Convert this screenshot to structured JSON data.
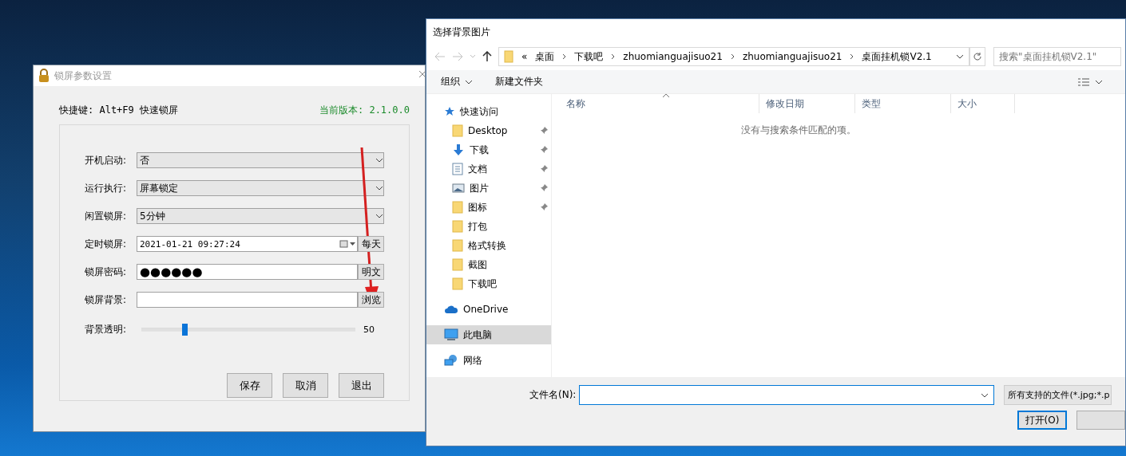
{
  "lock_dialog": {
    "title": "锁屏参数设置",
    "shortcut": "快捷键: Alt+F9 快速锁屏",
    "version": "当前版本: 2.1.0.0",
    "fields": [
      {
        "kind": "select",
        "label": "开机启动:",
        "value": "否"
      },
      {
        "kind": "select",
        "label": "运行执行:",
        "value": "屏幕锁定"
      },
      {
        "kind": "select",
        "label": "闲置锁屏:",
        "value": "5分钟"
      },
      {
        "kind": "datetime",
        "label": "定时锁屏:",
        "value": "2021-01-21 09:27:24",
        "button": "每天"
      },
      {
        "kind": "password",
        "label": "锁屏密码:",
        "value": "●●●●●●",
        "button": "明文"
      },
      {
        "kind": "file",
        "label": "锁屏背景:",
        "button": "浏览"
      },
      {
        "kind": "slider",
        "label": "背景透明:",
        "level": 0.2,
        "reading": "50"
      }
    ],
    "buttons": [
      "保存",
      "取消",
      "退出"
    ]
  },
  "file_dialog": {
    "title": "选择背景图片",
    "path_prefix": "«",
    "breadcrumbs": [
      "桌面",
      "下载吧",
      "zhuomianguajisuo21",
      "zhuomianguajisuo21",
      "桌面挂机锁V2.1"
    ],
    "search": {
      "placeholder": "搜索\"桌面挂机锁V2.1\""
    },
    "toolbar": {
      "organize": "组织",
      "new_folder": "新建文件夹"
    },
    "sidebar": [
      {
        "kind": "star",
        "label": "快速访问",
        "selected": false,
        "children": [
          {
            "kind": "folder",
            "label": "Desktop",
            "pinned": true,
            "selected": false
          },
          {
            "kind": "download",
            "label": "下载",
            "pinned": true,
            "selected": false
          },
          {
            "kind": "document",
            "label": "文档",
            "pinned": true,
            "selected": false
          },
          {
            "kind": "image",
            "label": "图片",
            "pinned": true,
            "selected": false
          },
          {
            "kind": "folder",
            "label": "图标",
            "pinned": true,
            "selected": false
          },
          {
            "kind": "folder",
            "label": "打包",
            "pinned": false,
            "selected": false
          },
          {
            "kind": "folder",
            "label": "格式转换",
            "pinned": false,
            "selected": false
          },
          {
            "kind": "folder",
            "label": "截图",
            "pinned": false,
            "selected": false
          },
          {
            "kind": "folder",
            "label": "下载吧",
            "pinned": false,
            "selected": false
          }
        ]
      },
      {
        "kind": "cloud",
        "label": "OneDrive",
        "selected": false
      },
      {
        "kind": "computer",
        "label": "此电脑",
        "selected": true
      },
      {
        "kind": "network",
        "label": "网络",
        "selected": false
      }
    ],
    "columns": [
      "名称",
      "修改日期",
      "类型",
      "大小"
    ],
    "empty_message": "没有与搜索条件匹配的项。",
    "filename_label": "文件名(N):",
    "filter": "所有支持的文件(*.jpg;*.p",
    "open_button": "打开(O)"
  }
}
